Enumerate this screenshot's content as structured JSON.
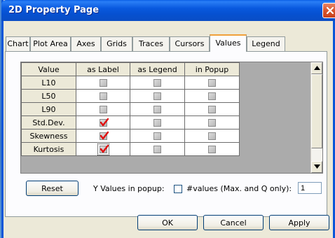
{
  "window": {
    "title": "2D Property Page"
  },
  "tabs": [
    {
      "label": "Chart"
    },
    {
      "label": "Plot Area"
    },
    {
      "label": "Axes"
    },
    {
      "label": "Grids"
    },
    {
      "label": "Traces"
    },
    {
      "label": "Cursors"
    },
    {
      "label": "Values"
    },
    {
      "label": "Legend"
    }
  ],
  "active_tab": "Values",
  "grid": {
    "headers": [
      "Value",
      "as Label",
      "as Legend",
      "in Popup"
    ],
    "rows": [
      {
        "label": "L10",
        "as_label": false,
        "as_legend": false,
        "in_popup": false
      },
      {
        "label": "L50",
        "as_label": false,
        "as_legend": false,
        "in_popup": false
      },
      {
        "label": "L90",
        "as_label": false,
        "as_legend": false,
        "in_popup": false
      },
      {
        "label": "Std.Dev.",
        "as_label": true,
        "as_legend": false,
        "in_popup": false
      },
      {
        "label": "Skewness",
        "as_label": true,
        "as_legend": false,
        "in_popup": false
      },
      {
        "label": "Kurtosis",
        "as_label": true,
        "as_legend": false,
        "in_popup": false
      }
    ],
    "check_color": "#e01010"
  },
  "controls": {
    "reset_label": "Reset",
    "popup_label": "Y Values in popup:",
    "popup_checked": false,
    "values_label": "#values (Max. and Q only):",
    "values_count": "1"
  },
  "buttons": {
    "ok_label": "OK",
    "cancel_label": "Cancel",
    "apply_label": "Apply"
  },
  "colors": {
    "title_bar": "#0a58de",
    "close_button": "#d8552c",
    "active_tab_accent": "#f0a03a",
    "dialog_bg": "#ece9d8"
  }
}
